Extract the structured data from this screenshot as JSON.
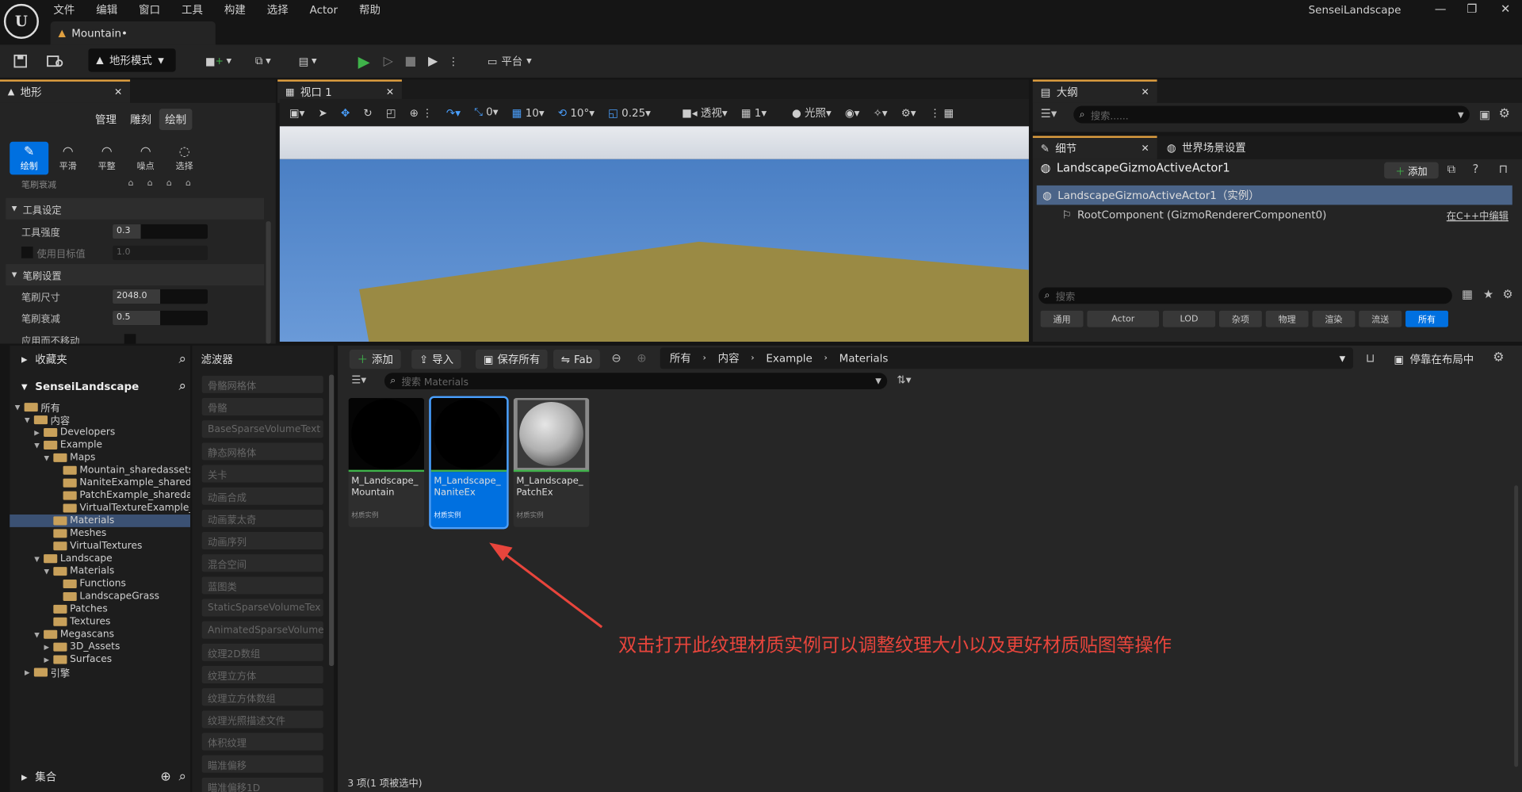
{
  "app": {
    "project_name": "SenseiLandscape",
    "logo_text": "U",
    "document_tab": "Mountain•",
    "mode_label": "地形模式",
    "platform_label": "平台",
    "menu": [
      "文件",
      "编辑",
      "窗口",
      "工具",
      "构建",
      "选择",
      "Actor",
      "帮助"
    ],
    "window_controls": [
      "—",
      "❐",
      "✕"
    ]
  },
  "landscape_panel": {
    "tab": "地形",
    "subtabs": [
      "管理",
      "雕刻",
      "绘制"
    ],
    "active_subtab": "绘制",
    "tools": [
      "绘制",
      "平滑",
      "平整",
      "噪点",
      "选择"
    ],
    "clipped_row": "笔刷衰减",
    "sections": {
      "tool_settings": "工具设定",
      "brush_settings": "笔刷设置"
    },
    "rows": {
      "tool_strength": {
        "label": "工具强度",
        "value": "0.3",
        "level": 0.3
      },
      "use_target": {
        "label": "使用目标值",
        "value": "1.0"
      },
      "brush_size": {
        "label": "笔刷尺寸",
        "value": "2048.0",
        "level": 0.5
      },
      "brush_falloff": {
        "label": "笔刷衰减",
        "value": "0.5",
        "level": 0.5
      },
      "apply_no_move": {
        "label": "应用而不移动"
      }
    }
  },
  "viewport": {
    "tab": "视口 1",
    "perspective": "透视",
    "lit": "光照",
    "grid_snap": "10",
    "rot_snap": "10°",
    "scale_snap": "0.25",
    "cam_speed": "1",
    "translate_snap": "0"
  },
  "outliner": {
    "tab": "大纲",
    "search_placeholder": "搜索......"
  },
  "details": {
    "tab": "细节",
    "tab2": "世界场景设置",
    "actor_name": "LandscapeGizmoActiveActor1",
    "add_label": "添加",
    "instance_row": "LandscapeGizmoActiveActor1（实例）",
    "component_row": "RootComponent (GizmoRendererComponent0)",
    "edit_cpp": "在C++中编辑",
    "search_placeholder": "搜索",
    "chips": [
      "通用",
      "Actor",
      "LOD",
      "杂项",
      "物理",
      "渲染",
      "流送",
      "所有"
    ],
    "active_chip": "所有"
  },
  "content_browser": {
    "favorites": "收藏夹",
    "project_root": "SenseiLandscape",
    "collections": "集合",
    "tree": [
      {
        "label": "所有",
        "depth": 0,
        "open": true
      },
      {
        "label": "内容",
        "depth": 1,
        "open": true
      },
      {
        "label": "Developers",
        "depth": 2,
        "open": false
      },
      {
        "label": "Example",
        "depth": 2,
        "open": true
      },
      {
        "label": "Maps",
        "depth": 3,
        "open": true
      },
      {
        "label": "Mountain_sharedassets",
        "depth": 4,
        "leaf": true
      },
      {
        "label": "NaniteExample_sharedass",
        "depth": 4,
        "leaf": true
      },
      {
        "label": "PatchExample_sharedasse",
        "depth": 4,
        "leaf": true
      },
      {
        "label": "VirtualTextureExample_sh",
        "depth": 4,
        "leaf": true
      },
      {
        "label": "Materials",
        "depth": 3,
        "leaf": true,
        "selected": true
      },
      {
        "label": "Meshes",
        "depth": 3,
        "leaf": true
      },
      {
        "label": "VirtualTextures",
        "depth": 3,
        "leaf": true
      },
      {
        "label": "Landscape",
        "depth": 2,
        "open": true
      },
      {
        "label": "Materials",
        "depth": 3,
        "open": true
      },
      {
        "label": "Functions",
        "depth": 4,
        "leaf": true
      },
      {
        "label": "LandscapeGrass",
        "depth": 4,
        "leaf": true
      },
      {
        "label": "Patches",
        "depth": 3,
        "leaf": true
      },
      {
        "label": "Textures",
        "depth": 3,
        "leaf": true
      },
      {
        "label": "Megascans",
        "depth": 2,
        "open": true
      },
      {
        "label": "3D_Assets",
        "depth": 3,
        "open": false
      },
      {
        "label": "Surfaces",
        "depth": 3,
        "open": false
      },
      {
        "label": "引擎",
        "depth": 1,
        "open": false
      }
    ],
    "filter_title": "滤波器",
    "filters": [
      "骨骼网格体",
      "骨骼",
      "BaseSparseVolumeText",
      "静态网格体",
      "关卡",
      "动画合成",
      "动画蒙太奇",
      "动画序列",
      "混合空间",
      "蓝图类",
      "StaticSparseVolumeTex",
      "AnimatedSparseVolume",
      "纹理2D数组",
      "纹理立方体",
      "纹理立方体数组",
      "纹理光照描述文件",
      "体积纹理",
      "瞄准偏移",
      "瞄准偏移1D"
    ],
    "toolbar": {
      "add": "添加",
      "import": "导入",
      "save_all": "保存所有",
      "fab": "Fab",
      "dock": "停靠在布局中"
    },
    "breadcrumb": [
      "所有",
      "内容",
      "Example",
      "Materials"
    ],
    "search_placeholder": "搜索 Materials",
    "assets": [
      {
        "name": "M_Landscape_\nMountain",
        "kind": "材质实例",
        "selected": false,
        "thumb": "black-sphere"
      },
      {
        "name": "M_Landscape_\nNaniteEx",
        "kind": "材质实例",
        "selected": true,
        "thumb": "black-sphere"
      },
      {
        "name": "M_Landscape_\nPatchEx",
        "kind": "材质实例",
        "selected": false,
        "thumb": "grey-sphere"
      }
    ],
    "status": "3 项(1 项被选中)"
  },
  "annotation": {
    "text": "双击打开此纹理材质实例可以调整纹理大小以及更好材质贴图等操作",
    "color": "#e8453c"
  },
  "colors": {
    "accent": "#0070e0",
    "play": "#3fb24a",
    "folder": "#c8a05a",
    "sky_top": "#4a7fc4",
    "sky_bottom": "#6a9ad8",
    "ground": "#9a8a44"
  }
}
